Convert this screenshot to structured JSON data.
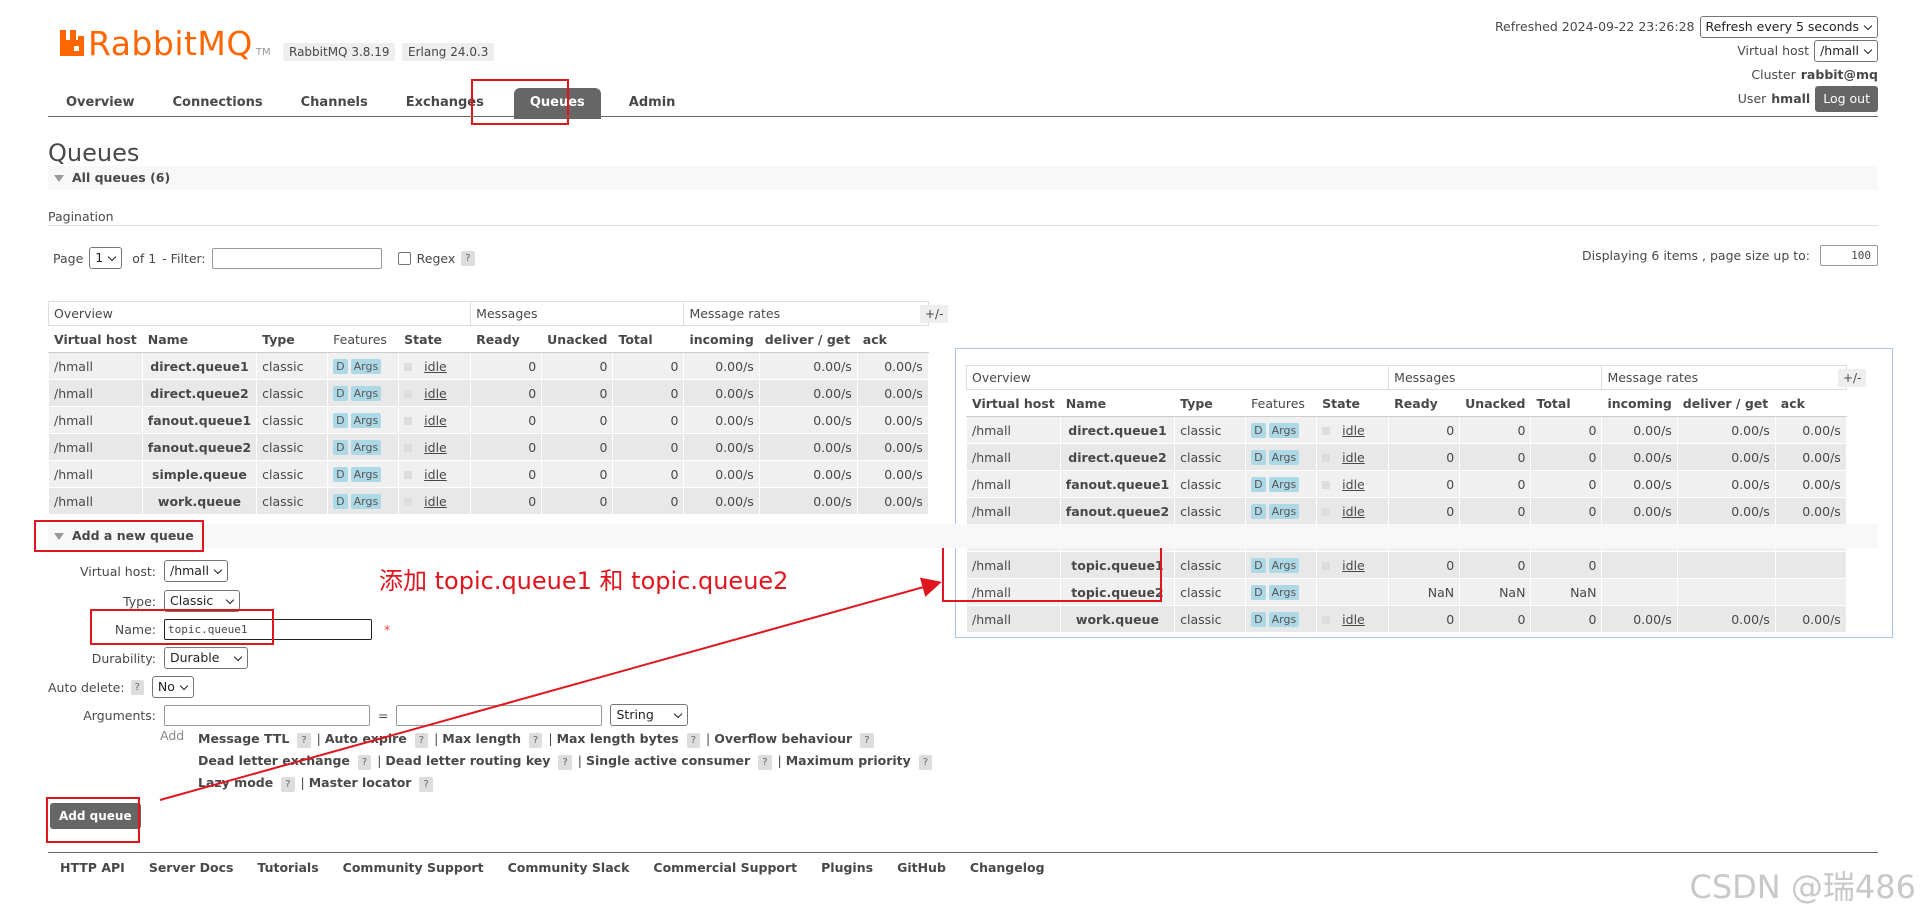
{
  "brand": {
    "name": "RabbitMQ",
    "tm": "TM",
    "version": "RabbitMQ 3.8.19",
    "erlang": "Erlang 24.0.3"
  },
  "nav": {
    "items": [
      "Overview",
      "Connections",
      "Channels",
      "Exchanges",
      "Queues",
      "Admin"
    ],
    "active": "Queues"
  },
  "header": {
    "refreshed_label": "Refreshed 2024-09-22 23:26:28",
    "refresh_select": "Refresh every 5 seconds",
    "vhost_label": "Virtual host",
    "vhost_select": "/hmall",
    "cluster_label": "Cluster",
    "cluster_value": "rabbit@mq",
    "user_label": "User",
    "user_value": "hmall",
    "logout": "Log out"
  },
  "page": {
    "title": "Queues",
    "all_queues": "All queues (6)",
    "pagination": "Pagination"
  },
  "pager": {
    "page_label": "Page",
    "page_value": "1",
    "of": "of 1",
    "filter_label": "- Filter:",
    "regex": "Regex",
    "help": "?",
    "displaying": "Displaying 6 items , page size up to:",
    "page_size": "100"
  },
  "table": {
    "groups": [
      "Overview",
      "Messages",
      "Message rates"
    ],
    "plusminus": "+/-",
    "headers": [
      "Virtual host",
      "Name",
      "Type",
      "Features",
      "State",
      "Ready",
      "Unacked",
      "Total",
      "incoming",
      "deliver / get",
      "ack"
    ],
    "rows": [
      [
        "/hmall",
        "direct.queue1",
        "classic",
        "idle",
        "0",
        "0",
        "0",
        "0.00/s",
        "0.00/s",
        "0.00/s"
      ],
      [
        "/hmall",
        "direct.queue2",
        "classic",
        "idle",
        "0",
        "0",
        "0",
        "0.00/s",
        "0.00/s",
        "0.00/s"
      ],
      [
        "/hmall",
        "fanout.queue1",
        "classic",
        "idle",
        "0",
        "0",
        "0",
        "0.00/s",
        "0.00/s",
        "0.00/s"
      ],
      [
        "/hmall",
        "fanout.queue2",
        "classic",
        "idle",
        "0",
        "0",
        "0",
        "0.00/s",
        "0.00/s",
        "0.00/s"
      ],
      [
        "/hmall",
        "simple.queue",
        "classic",
        "idle",
        "0",
        "0",
        "0",
        "0.00/s",
        "0.00/s",
        "0.00/s"
      ],
      [
        "/hmall",
        "work.queue",
        "classic",
        "idle",
        "0",
        "0",
        "0",
        "0.00/s",
        "0.00/s",
        "0.00/s"
      ]
    ],
    "feature_d": "D",
    "feature_args": "Args"
  },
  "zoom_table": {
    "rows": [
      [
        "/hmall",
        "direct.queue1",
        "classic",
        "idle",
        "0",
        "0",
        "0",
        "0.00/s",
        "0.00/s",
        "0.00/s"
      ],
      [
        "/hmall",
        "direct.queue2",
        "classic",
        "idle",
        "0",
        "0",
        "0",
        "0.00/s",
        "0.00/s",
        "0.00/s"
      ],
      [
        "/hmall",
        "fanout.queue1",
        "classic",
        "idle",
        "0",
        "0",
        "0",
        "0.00/s",
        "0.00/s",
        "0.00/s"
      ],
      [
        "/hmall",
        "fanout.queue2",
        "classic",
        "idle",
        "0",
        "0",
        "0",
        "0.00/s",
        "0.00/s",
        "0.00/s"
      ],
      [
        "/hmall",
        "simple.queue",
        "classic",
        "idle",
        "0",
        "0",
        "0",
        "0.00/s",
        "0.00/s",
        "0.00/s"
      ],
      [
        "/hmall",
        "topic.queue1",
        "classic",
        "idle",
        "0",
        "0",
        "0",
        "",
        "",
        ""
      ],
      [
        "/hmall",
        "topic.queue2",
        "classic",
        "",
        "NaN",
        "NaN",
        "NaN",
        "",
        "",
        ""
      ],
      [
        "/hmall",
        "work.queue",
        "classic",
        "idle",
        "0",
        "0",
        "0",
        "0.00/s",
        "0.00/s",
        "0.00/s"
      ]
    ]
  },
  "form": {
    "section": "Add a new queue",
    "vhost_label": "Virtual host:",
    "vhost_value": "/hmall",
    "type_label": "Type:",
    "type_value": "Classic",
    "name_label": "Name:",
    "name_value": "topic.queue1",
    "required": "*",
    "durability_label": "Durability:",
    "durability_value": "Durable",
    "autodelete_label": "Auto delete:",
    "autodelete_value": "No",
    "arguments_label": "Arguments:",
    "equals": "=",
    "arg_type": "String",
    "add_label": "Add",
    "arg_links": [
      [
        "Message TTL",
        "Auto expire",
        "Max length",
        "Max length bytes",
        "Overflow behaviour"
      ],
      [
        "Dead letter exchange",
        "Dead letter routing key",
        "Single active consumer",
        "Maximum priority"
      ],
      [
        "Lazy mode",
        "Master locator"
      ]
    ],
    "submit": "Add queue"
  },
  "annotation": "添加 topic.queue1 和 topic.queue2",
  "footer": [
    "HTTP API",
    "Server Docs",
    "Tutorials",
    "Community Support",
    "Community Slack",
    "Commercial Support",
    "Plugins",
    "GitHub",
    "Changelog"
  ],
  "watermark": "CSDN @瑞486",
  "colors": {
    "brand_orange": "#ff6600",
    "annotation_red": "#e0161f",
    "nav_active": "#666666",
    "feature_badge": "#add8e6"
  }
}
